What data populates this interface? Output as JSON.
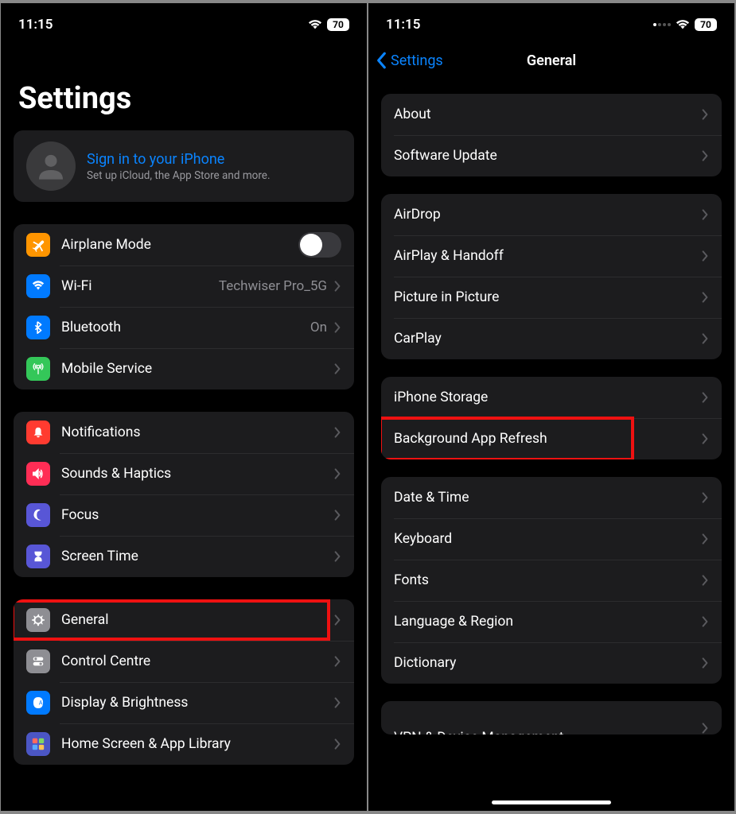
{
  "status": {
    "time": "11:15",
    "battery": "70"
  },
  "left": {
    "title": "Settings",
    "signin": {
      "title": "Sign in to your iPhone",
      "subtitle": "Set up iCloud, the App Store and more."
    },
    "g1": [
      {
        "icon": "airplane",
        "bg": "#ff9500",
        "label": "Airplane Mode",
        "toggle": true,
        "id": "airplane-mode"
      },
      {
        "icon": "wifi",
        "bg": "#007aff",
        "label": "Wi-Fi",
        "value": "Techwiser Pro_5G",
        "id": "wifi"
      },
      {
        "icon": "bluetooth",
        "bg": "#007aff",
        "label": "Bluetooth",
        "value": "On",
        "id": "bluetooth"
      },
      {
        "icon": "antenna",
        "bg": "#34c759",
        "label": "Mobile Service",
        "id": "mobile-service"
      }
    ],
    "g2": [
      {
        "icon": "bell",
        "bg": "#ff3b30",
        "label": "Notifications",
        "id": "notifications"
      },
      {
        "icon": "speaker",
        "bg": "#ff2d55",
        "label": "Sounds & Haptics",
        "id": "sounds-haptics"
      },
      {
        "icon": "moon",
        "bg": "#5856d6",
        "label": "Focus",
        "id": "focus"
      },
      {
        "icon": "hourglass",
        "bg": "#5856d6",
        "label": "Screen Time",
        "id": "screen-time"
      }
    ],
    "g3": [
      {
        "icon": "gear",
        "bg": "#8e8e93",
        "label": "General",
        "id": "general",
        "highlight": true
      },
      {
        "icon": "switches",
        "bg": "#8e8e93",
        "label": "Control Centre",
        "id": "control-centre"
      },
      {
        "icon": "display",
        "bg": "#007aff",
        "label": "Display & Brightness",
        "id": "display-brightness"
      },
      {
        "icon": "grid",
        "bg": "#4b56c4",
        "label": "Home Screen & App Library",
        "id": "home-screen"
      }
    ]
  },
  "right": {
    "back": "Settings",
    "title": "General",
    "g1": [
      {
        "label": "About",
        "id": "about"
      },
      {
        "label": "Software Update",
        "id": "software-update"
      }
    ],
    "g2": [
      {
        "label": "AirDrop",
        "id": "airdrop"
      },
      {
        "label": "AirPlay & Handoff",
        "id": "airplay-handoff"
      },
      {
        "label": "Picture in Picture",
        "id": "picture-in-picture"
      },
      {
        "label": "CarPlay",
        "id": "carplay"
      }
    ],
    "g3": [
      {
        "label": "iPhone Storage",
        "id": "iphone-storage"
      },
      {
        "label": "Background App Refresh",
        "id": "background-app-refresh",
        "highlight": true
      }
    ],
    "g4": [
      {
        "label": "Date & Time",
        "id": "date-time"
      },
      {
        "label": "Keyboard",
        "id": "keyboard"
      },
      {
        "label": "Fonts",
        "id": "fonts"
      },
      {
        "label": "Language & Region",
        "id": "language-region"
      },
      {
        "label": "Dictionary",
        "id": "dictionary"
      }
    ],
    "g5": [
      {
        "label": "VPN & Device Management",
        "id": "vpn-device-management"
      }
    ]
  }
}
